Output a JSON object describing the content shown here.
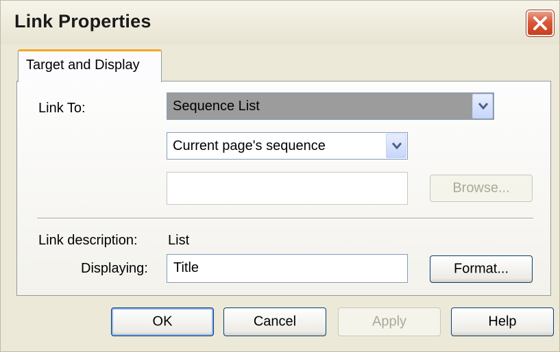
{
  "window": {
    "title": "Link Properties"
  },
  "tabs": [
    {
      "label": "Target and Display",
      "active": true
    }
  ],
  "link_to": {
    "label": "Link To:",
    "type_value": "Sequence List",
    "sequence_value": "Current page's sequence",
    "path_value": "",
    "browse_label": "Browse..."
  },
  "description": {
    "label": "Link description:",
    "value": "List",
    "displaying_label": "Displaying:",
    "displaying_value": "Title",
    "format_label": "Format..."
  },
  "buttons": {
    "ok": "OK",
    "cancel": "Cancel",
    "apply": "Apply",
    "help": "Help"
  },
  "colors": {
    "dialog_bg": "#ece9d8",
    "tab_accent": "#f5a623",
    "close_red": "#d9583a",
    "field_border": "#7f9db9"
  }
}
